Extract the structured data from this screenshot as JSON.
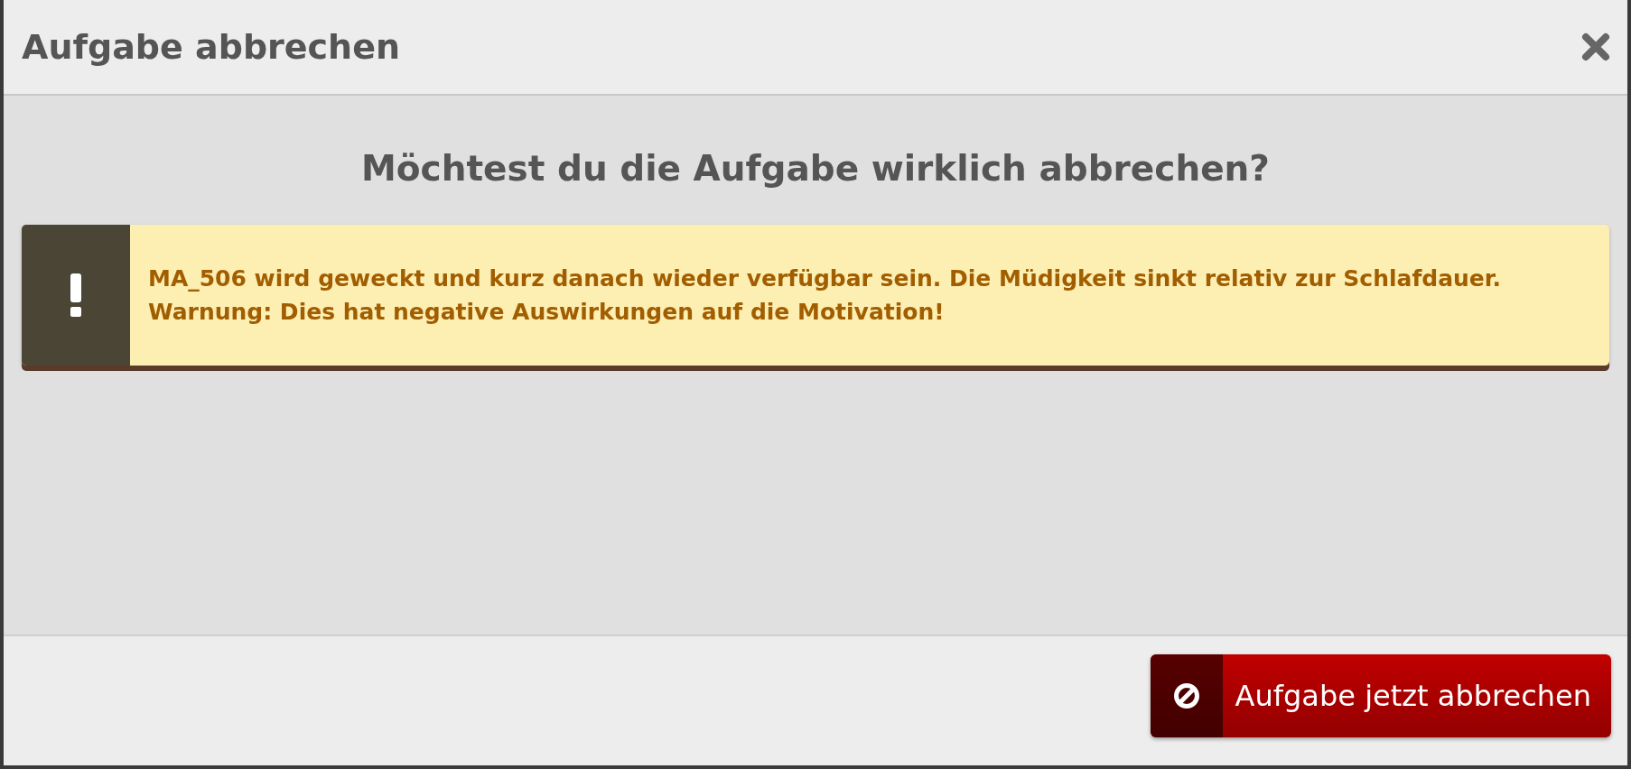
{
  "dialog": {
    "title": "Aufgabe abbrechen",
    "question": "Möchtest du die Aufgabe wirklich abbrechen?",
    "warning": {
      "kind": "warning",
      "text": "MA_506 wird geweckt und kurz danach wieder verfügbar sein. Die Müdigkeit sinkt relativ zur Schlafdauer. Warnung: Dies hat negative Auswirkungen auf die Motivation!"
    },
    "buttons": [
      {
        "kind": "danger",
        "label": "Aufgabe jetzt abbrechen"
      }
    ]
  }
}
